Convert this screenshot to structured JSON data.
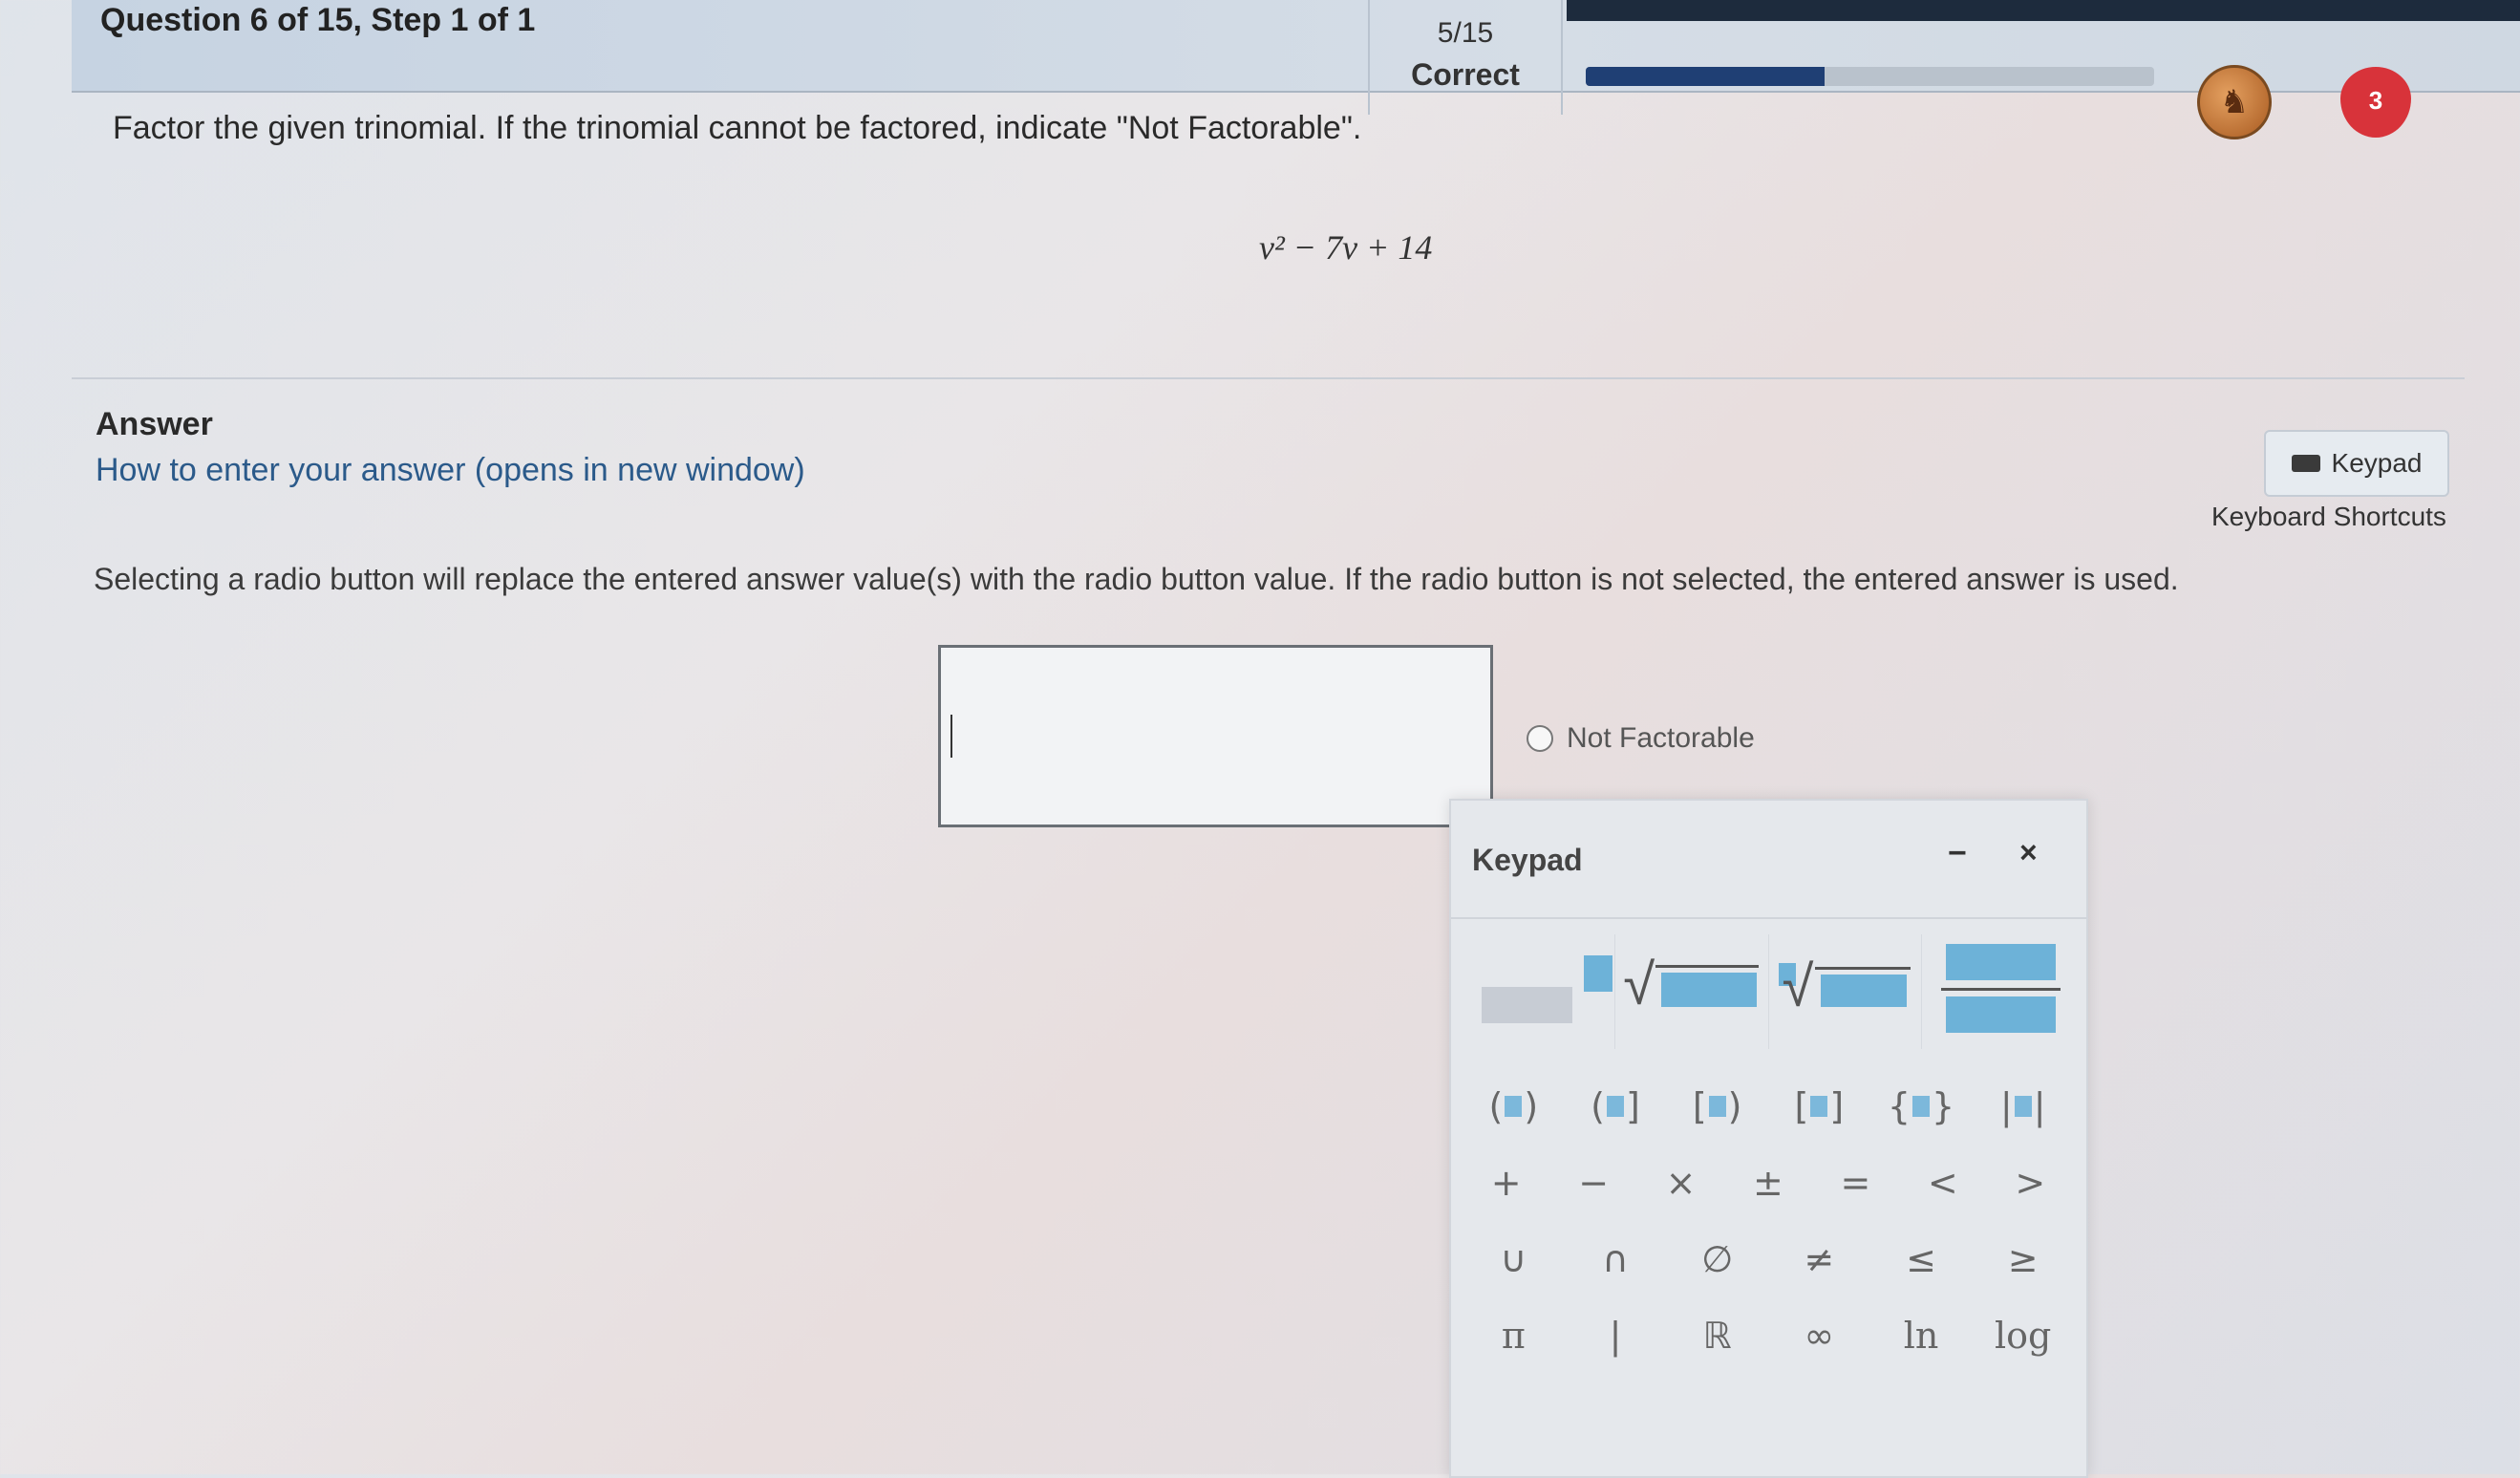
{
  "header": {
    "question_title": "Question 6 of 15, Step 1 of 1",
    "score": "5/15",
    "status": "Correct",
    "progress_fraction": 0.42,
    "lives": "3"
  },
  "question": {
    "instruction": "Factor the given trinomial. If the trinomial cannot be factored, indicate \"Not Factorable\".",
    "expression": "v² − 7v + 14"
  },
  "answer": {
    "label": "Answer",
    "help_link": "How to enter your answer (opens in new window)",
    "keypad_button": "Keypad",
    "shortcuts_link": "Keyboard Shortcuts",
    "radio_note": "Selecting a radio button will replace the entered answer value(s) with the radio button value. If the radio button is not selected, the entered answer is used.",
    "radio_label": "Not Factorable"
  },
  "keypad": {
    "title": "Keypad",
    "minimize": "−",
    "close": "×",
    "template_keys": [
      "exponent",
      "square-root",
      "nth-root",
      "fraction"
    ],
    "rows": [
      [
        "(■)",
        "(■]",
        "[■)",
        "[■]",
        "{■}",
        "|■|"
      ],
      [
        "+",
        "−",
        "×",
        "±",
        "=",
        "<",
        ">"
      ],
      [
        "∪",
        "∩",
        "∅",
        "≠",
        "≤",
        "≥"
      ],
      [
        "π",
        "|",
        "ℝ",
        "∞",
        "ln",
        "log"
      ]
    ]
  },
  "colors": {
    "accent": "#1f3f74",
    "heart": "#d8333a",
    "placeholder": "#6db2d8",
    "link": "#2b5a8a"
  }
}
